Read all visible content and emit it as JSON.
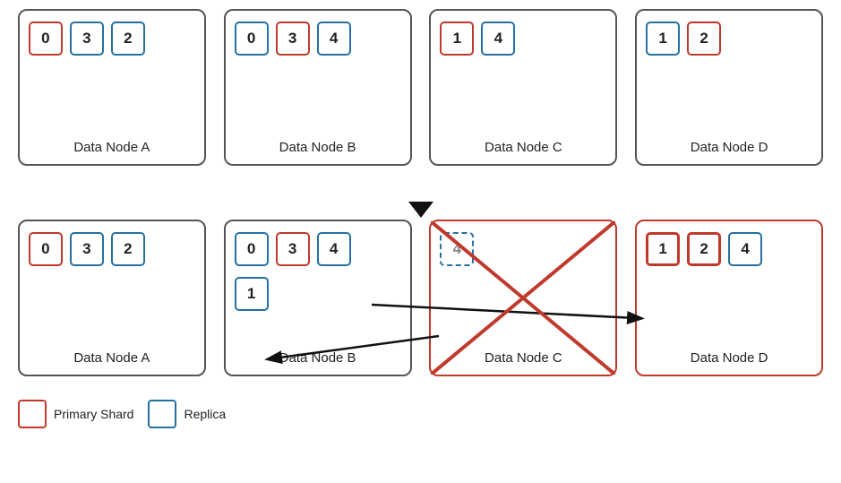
{
  "nodes": {
    "top": [
      {
        "label": "Data Node A",
        "shards": [
          {
            "id": "0",
            "type": "primary"
          },
          {
            "id": "3",
            "type": "replica"
          },
          {
            "id": "2",
            "type": "replica"
          }
        ]
      },
      {
        "label": "Data Node B",
        "shards": [
          {
            "id": "0",
            "type": "replica"
          },
          {
            "id": "3",
            "type": "primary"
          },
          {
            "id": "4",
            "type": "replica"
          }
        ]
      },
      {
        "label": "Data Node C",
        "shards": [
          {
            "id": "1",
            "type": "primary"
          },
          {
            "id": "4",
            "type": "replica"
          }
        ]
      },
      {
        "label": "Data Node D",
        "shards": [
          {
            "id": "1",
            "type": "replica"
          },
          {
            "id": "2",
            "type": "primary"
          }
        ]
      }
    ],
    "bottom": [
      {
        "label": "Data Node A",
        "shards_row1": [
          {
            "id": "0",
            "type": "primary"
          },
          {
            "id": "3",
            "type": "replica"
          },
          {
            "id": "2",
            "type": "replica"
          }
        ],
        "shards_row2": []
      },
      {
        "label": "Data Node B",
        "shards_row1": [
          {
            "id": "0",
            "type": "replica"
          },
          {
            "id": "3",
            "type": "primary"
          },
          {
            "id": "4",
            "type": "replica"
          }
        ],
        "shards_row2": [
          {
            "id": "1",
            "type": "replica"
          }
        ]
      },
      {
        "label": "Data Node C",
        "failed": true,
        "shards_row1": [
          {
            "id": "4",
            "type": "dashed"
          }
        ],
        "shards_row2": []
      },
      {
        "label": "Data Node D",
        "shards_row1": [
          {
            "id": "1",
            "type": "primary_bold"
          },
          {
            "id": "2",
            "type": "primary_bold"
          },
          {
            "id": "4",
            "type": "replica"
          }
        ],
        "shards_row2": []
      }
    ]
  },
  "legend": {
    "primary_label": "Primary Shard",
    "replica_label": "Replica"
  },
  "arrow": "↓"
}
